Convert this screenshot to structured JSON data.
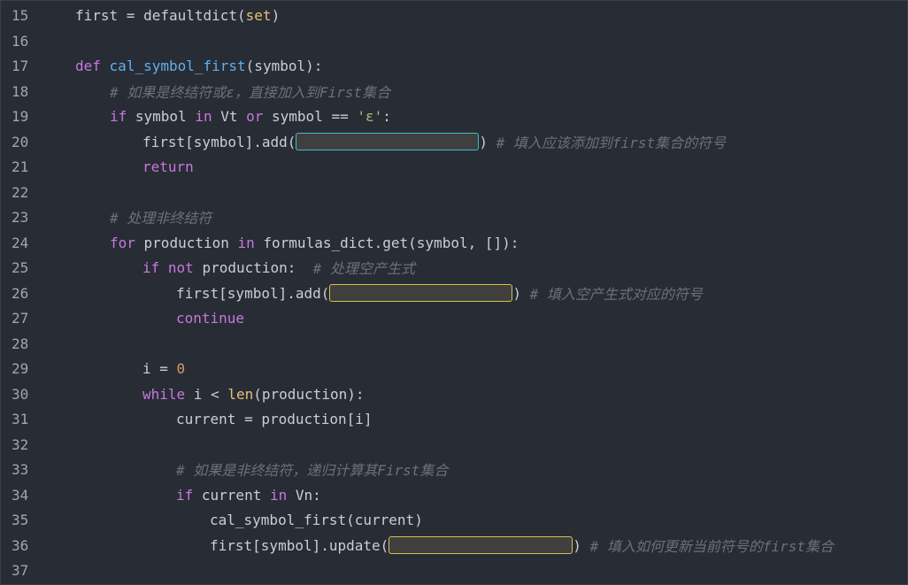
{
  "editor": {
    "lines": [
      {
        "n": "15",
        "parts": [
          "first = defaultdict(",
          "set",
          ")"
        ]
      },
      {
        "n": "16"
      },
      {
        "n": "17",
        "parts": [
          "def",
          " ",
          "cal_symbol_first",
          "(symbol):"
        ]
      },
      {
        "n": "18",
        "parts": [
          "# 如果是终结符或ε，直接加入到First集合"
        ]
      },
      {
        "n": "19",
        "parts": [
          "if",
          " symbol ",
          "in",
          " Vt ",
          "or",
          " symbol == ",
          "'ε'",
          ":"
        ]
      },
      {
        "n": "20",
        "parts": [
          "first[symbol].add(",
          ") ",
          "# 填入应该添加到first集合的符号"
        ]
      },
      {
        "n": "21",
        "parts": [
          "return"
        ]
      },
      {
        "n": "22"
      },
      {
        "n": "23",
        "parts": [
          "# 处理非终结符"
        ]
      },
      {
        "n": "24",
        "parts": [
          "for",
          " production ",
          "in",
          " formulas_dict.get(symbol, []):"
        ]
      },
      {
        "n": "25",
        "parts": [
          "if",
          " ",
          "not",
          " production:  ",
          "# 处理空产生式"
        ]
      },
      {
        "n": "26",
        "parts": [
          "first[symbol].add(",
          ") ",
          "# 填入空产生式对应的符号"
        ]
      },
      {
        "n": "27",
        "parts": [
          "continue"
        ]
      },
      {
        "n": "28"
      },
      {
        "n": "29",
        "parts": [
          "i = ",
          "0"
        ]
      },
      {
        "n": "30",
        "parts": [
          "while",
          " i < ",
          "len",
          "(production):"
        ]
      },
      {
        "n": "31",
        "parts": [
          "current = production[i]"
        ]
      },
      {
        "n": "32"
      },
      {
        "n": "33",
        "parts": [
          "# 如果是非终结符，递归计算其First集合"
        ]
      },
      {
        "n": "34",
        "parts": [
          "if",
          " current ",
          "in",
          " Vn:"
        ]
      },
      {
        "n": "35",
        "parts": [
          "cal_symbol_first(current)"
        ]
      },
      {
        "n": "36",
        "parts": [
          "first[symbol].update(",
          ") ",
          "# 填入如何更新当前符号的first集合"
        ]
      },
      {
        "n": "37"
      }
    ]
  }
}
